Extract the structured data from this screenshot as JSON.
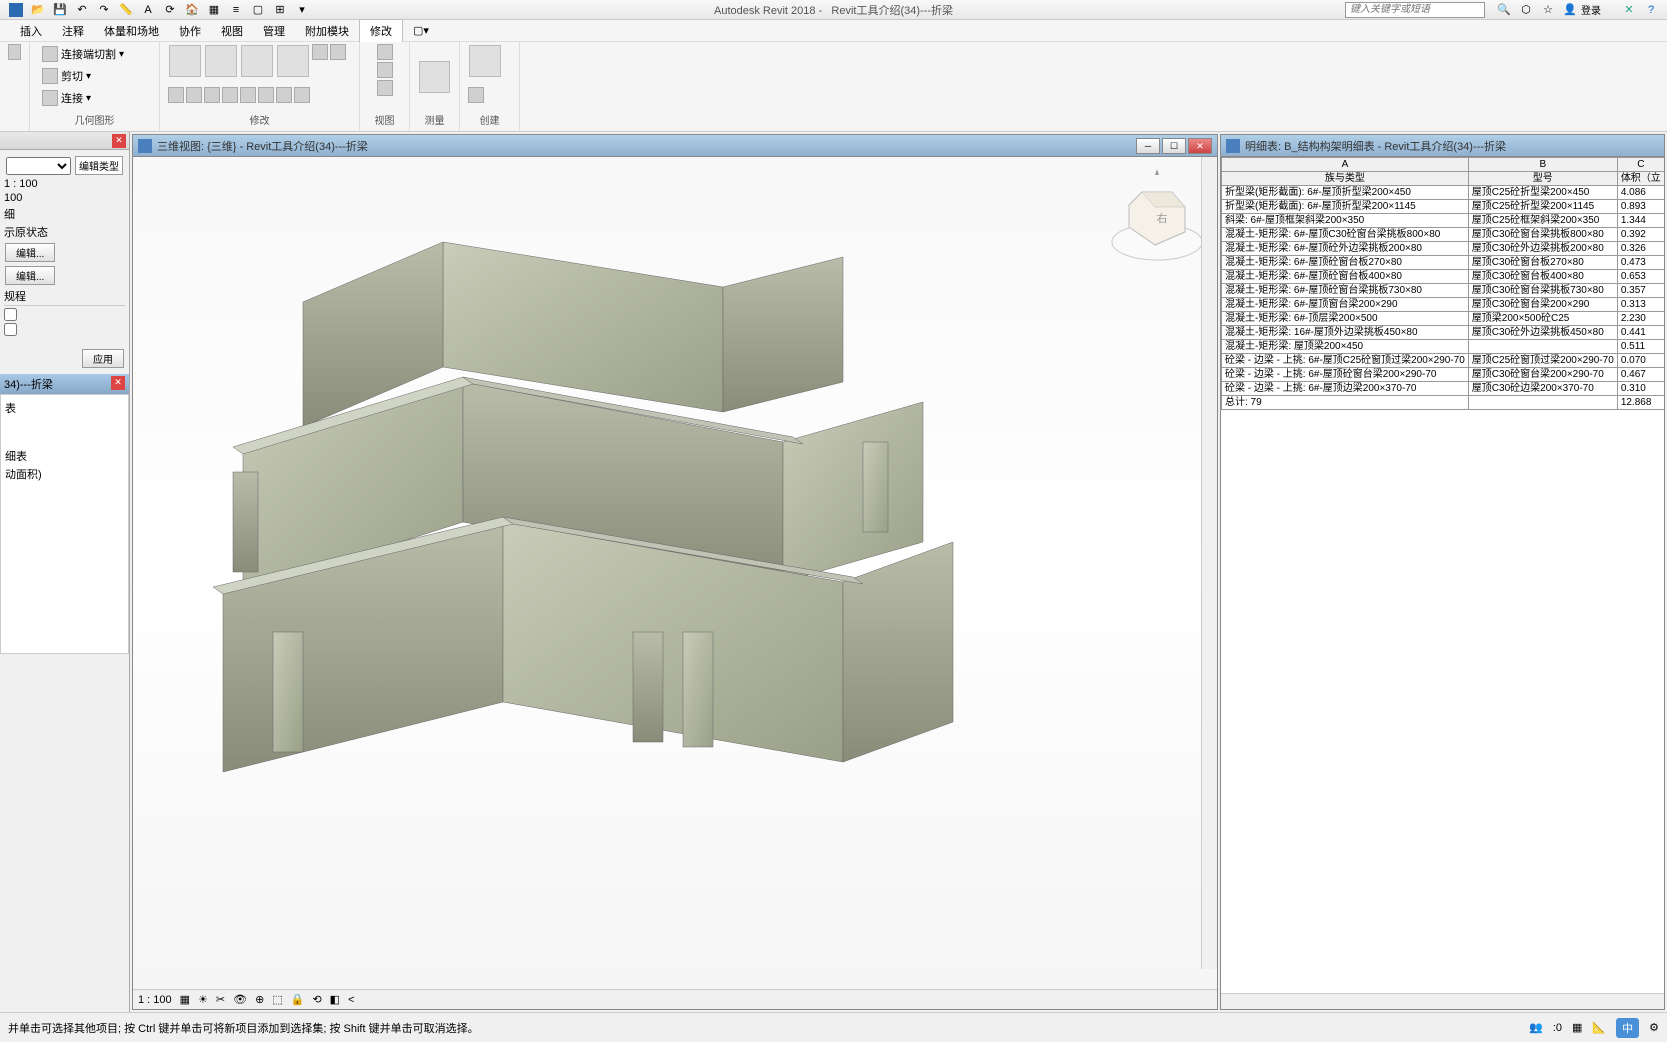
{
  "app": {
    "title": "Autodesk Revit 2018 -",
    "document": "Revit工具介绍(34)---折梁",
    "search_placeholder": "键入关键字或短语",
    "login": "登录"
  },
  "menu": {
    "items": [
      "插入",
      "注释",
      "体量和场地",
      "协作",
      "视图",
      "管理",
      "附加模块",
      "修改"
    ]
  },
  "ribbon": {
    "groups": {
      "geometry": "几何图形",
      "modify": "修改",
      "view": "视图",
      "measure": "测量",
      "create": "创建"
    },
    "buttons": {
      "join_cut": "连接端切割",
      "cut": "剪切",
      "join": "连接"
    }
  },
  "properties": {
    "edit_type": "编辑类型",
    "scale": "1 : 100",
    "scale_val": "100",
    "detail": "细",
    "show_original": "示原状态",
    "edit1": "编辑...",
    "edit2": "编辑...",
    "rules": "规程",
    "apply": "应用",
    "tab2": "34)---折梁",
    "sec1": "表",
    "sec2": "细表",
    "sec3": "动面积)"
  },
  "view3d": {
    "title": "三维视图: {三维} - Revit工具介绍(34)---折梁",
    "bottom_scale": "1 : 100",
    "cube_face": "右"
  },
  "schedule": {
    "title": "明细表: B_结构构架明细表 - Revit工具介绍(34)---折梁",
    "headers": {
      "a": "A",
      "b": "B",
      "c": "C"
    },
    "subheaders": {
      "a": "族与类型",
      "b": "型号",
      "c": "体积（立"
    },
    "rows": [
      {
        "a": "折型梁(矩形截面): 6#-屋顶折型梁200×450",
        "b": "屋顶C25砼折型梁200×450",
        "c": "4.086"
      },
      {
        "a": "折型梁(矩形截面): 6#-屋顶折型梁200×1145",
        "b": "屋顶C25砼折型梁200×1145",
        "c": "0.893"
      },
      {
        "a": "斜梁: 6#-屋顶框架斜梁200×350",
        "b": "屋顶C25砼框架斜梁200×350",
        "c": "1.344"
      },
      {
        "a": "混凝土-矩形梁: 6#-屋顶C30砼窗台梁挑板800×80",
        "b": "屋顶C30砼窗台梁挑板800×80",
        "c": "0.392"
      },
      {
        "a": "混凝土-矩形梁: 6#-屋顶砼外边梁挑板200×80",
        "b": "屋顶C30砼外边梁挑板200×80",
        "c": "0.326"
      },
      {
        "a": "混凝土-矩形梁: 6#-屋顶砼窗台板270×80",
        "b": "屋顶C30砼窗台板270×80",
        "c": "0.473"
      },
      {
        "a": "混凝土-矩形梁: 6#-屋顶砼窗台板400×80",
        "b": "屋顶C30砼窗台板400×80",
        "c": "0.653"
      },
      {
        "a": "混凝土-矩形梁: 6#-屋顶砼窗台梁挑板730×80",
        "b": "屋顶C30砼窗台梁挑板730×80",
        "c": "0.357"
      },
      {
        "a": "混凝土-矩形梁: 6#-屋顶窗台梁200×290",
        "b": "屋顶C30砼窗台梁200×290",
        "c": "0.313"
      },
      {
        "a": "混凝土-矩形梁: 6#-顶层梁200×500",
        "b": "屋顶梁200×500砼C25",
        "c": "2.230"
      },
      {
        "a": "混凝土-矩形梁: 16#-屋顶外边梁挑板450×80",
        "b": "屋顶C30砼外边梁挑板450×80",
        "c": "0.441"
      },
      {
        "a": "混凝土-矩形梁: 屋顶梁200×450",
        "b": "",
        "c": "0.511"
      },
      {
        "a": "砼梁 - 边梁 - 上挑: 6#-屋顶C25砼窗顶过梁200×290-70",
        "b": "屋顶C25砼窗顶过梁200×290-70",
        "c": "0.070"
      },
      {
        "a": "砼梁 - 边梁 - 上挑: 6#-屋顶砼窗台梁200×290-70",
        "b": "屋顶C30砼窗台梁200×290-70",
        "c": "0.467"
      },
      {
        "a": "砼梁 - 边梁 - 上挑: 6#-屋顶边梁200×370-70",
        "b": "屋顶C30砼边梁200×370-70",
        "c": "0.310"
      }
    ],
    "total": {
      "label": "总计: 79",
      "value": "12.868"
    }
  },
  "status": {
    "hint": "并单击可选择其他项目; 按 Ctrl 键并单击可将新项目添加到选择集; 按 Shift 键并单击可取消选择。",
    "count": ":0",
    "lang": "中"
  }
}
